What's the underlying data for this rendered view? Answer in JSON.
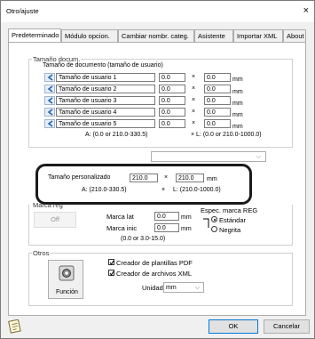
{
  "window": {
    "title": "Otro/ajuste",
    "close": "×"
  },
  "tabs": [
    "Predeterminado",
    "Módulo opcion.",
    "Cambiar nombr. categ.",
    "Asistente",
    "Importar XML",
    "About"
  ],
  "doc_size": {
    "group_label": "Tamaño docum.",
    "header": "Tamaño de documento (tamaño de usuario)",
    "rows": [
      {
        "name": "Tamaño de usuario 1",
        "w": "0.0",
        "h": "0.0"
      },
      {
        "name": "Tamaño de usuario 2",
        "w": "0.0",
        "h": "0.0"
      },
      {
        "name": "Tamaño de usuario 3",
        "w": "0.0",
        "h": "0.0"
      },
      {
        "name": "Tamaño de usuario 4",
        "w": "0.0",
        "h": "0.0"
      },
      {
        "name": "Tamaño de usuario 5",
        "w": "0.0",
        "h": "0.0"
      }
    ],
    "times": "×",
    "unit": "mm",
    "range_a": "A:   (0.0 or 210.0-330.5)",
    "range_l": "×  L:     (0.0 or 210.0-1000.0)"
  },
  "custom": {
    "label": "Tamaño personalizado",
    "w": "210.0",
    "h": "210.0",
    "times": "×",
    "unit": "mm",
    "range_a": "A:      (210.0-330.5)",
    "range_x": "×",
    "range_l": "L:      (210.0-1000.0)"
  },
  "reg": {
    "group_label": "Marca reg",
    "toggle": "Off",
    "lat_label": "Marca lat",
    "lat_value": "0.0",
    "inic_label": "Marca inic",
    "inic_value": "0.0",
    "unit": "mm",
    "range": "(0.0 or 3.0-15.0)",
    "espec_label": "Espec. marca REG",
    "opt_standard": "Estándar",
    "opt_black": "Negrita"
  },
  "otros": {
    "group_label": "Otros",
    "func_label": "Función",
    "chk_pdf": "Creador de plantillas PDF",
    "chk_xml": "Creador de archivos XML",
    "unit_label": "Unidad",
    "unit_value": "mm"
  },
  "buttons": {
    "ok": "OK",
    "cancel": "Cancelar"
  }
}
